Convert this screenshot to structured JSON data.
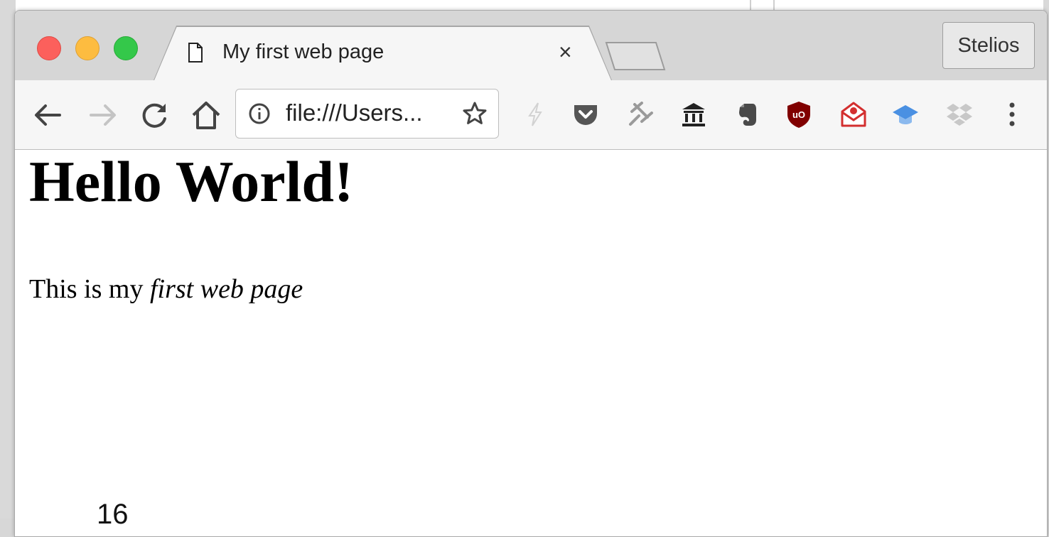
{
  "tab": {
    "title": "My first web page",
    "close_glyph": "×"
  },
  "profile": {
    "label": "Stelios"
  },
  "omnibox": {
    "url": "file:///Users..."
  },
  "extensions": [
    "lightning-icon",
    "pocket-icon",
    "pin-icon",
    "bank-icon",
    "evernote-icon",
    "ublock-icon",
    "mail-icon",
    "graduation-cap-icon",
    "dropbox-icon"
  ],
  "page": {
    "heading": "Hello World!",
    "paragraph_prefix": "This is my ",
    "paragraph_emphasis": "first web page"
  },
  "slide": {
    "number": "16"
  },
  "colors": {
    "traffic_close": "#fc605c",
    "traffic_min": "#fdbc40",
    "traffic_max": "#34c84a",
    "ublock": "#800000",
    "mail": "#d32f2f",
    "cap": "#4a90e2"
  }
}
